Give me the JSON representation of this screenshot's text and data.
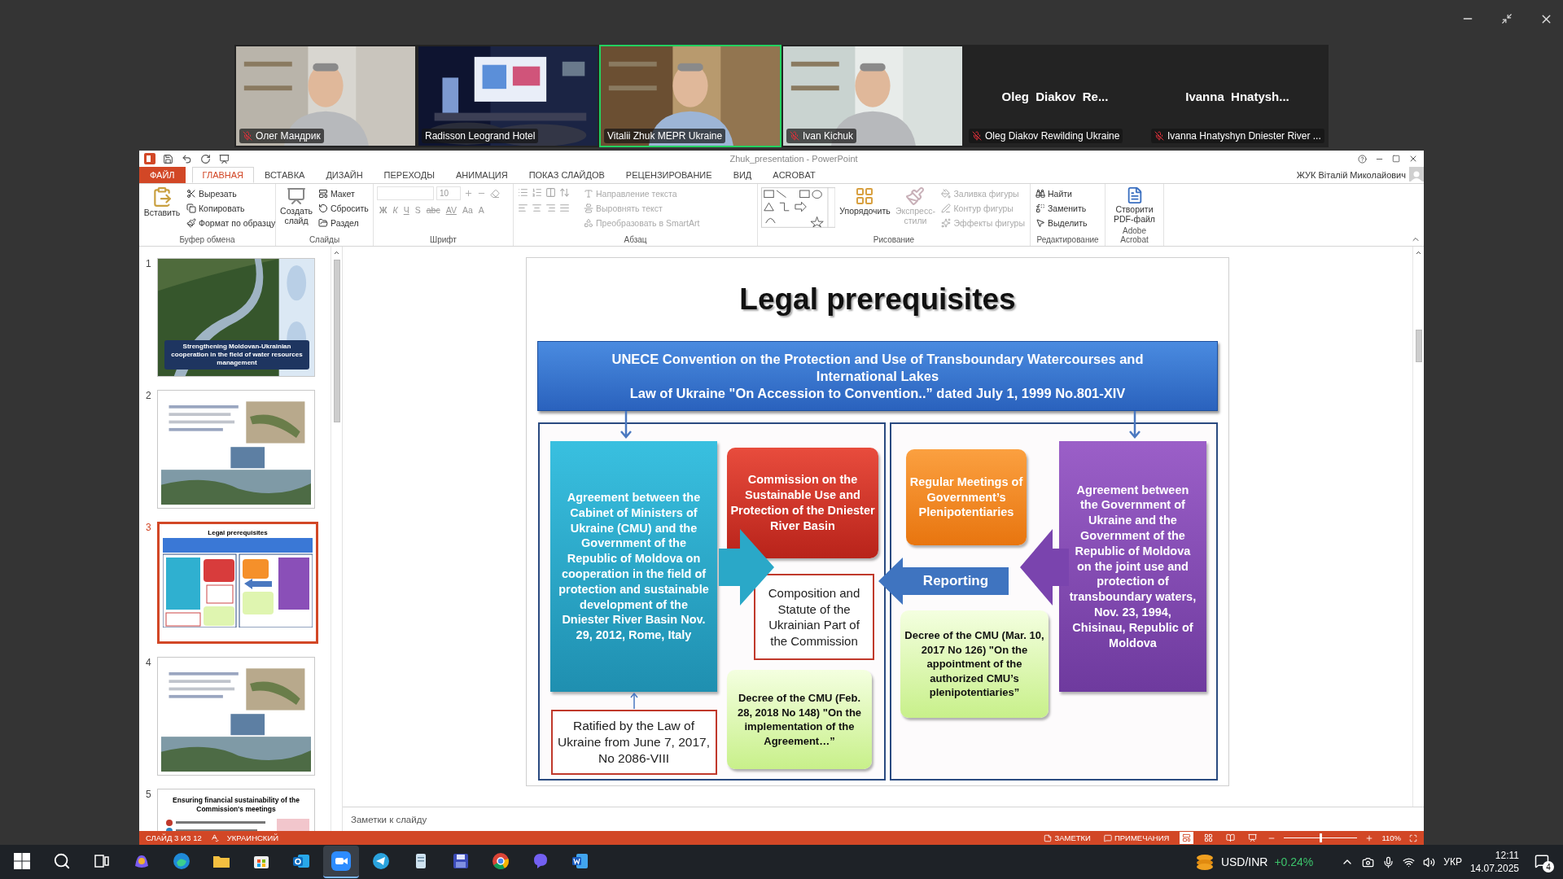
{
  "meeting": {
    "participants": [
      {
        "name": "Олег Мандрик",
        "kind": "video",
        "muted": true,
        "speaking": false
      },
      {
        "name": "Radisson Leogrand Hotel",
        "kind": "video",
        "muted": false,
        "speaking": false
      },
      {
        "name": "Vitalii Zhuk MEPR Ukraine",
        "kind": "video",
        "muted": false,
        "speaking": true
      },
      {
        "name": "Ivan Kichuk",
        "kind": "video",
        "muted": true,
        "speaking": false
      },
      {
        "name": "Oleg Diakov Rewilding Ukraine",
        "display_name": "Oleg  Diakov  Re...",
        "kind": "name",
        "muted": true,
        "speaking": false
      },
      {
        "name": "Ivanna Hnatyshyn Dniester River ...",
        "display_name": "Ivanna  Hnatysh...",
        "kind": "name",
        "muted": true,
        "speaking": false
      }
    ]
  },
  "powerpoint": {
    "title": "Zhuk_presentation - PowerPoint",
    "user": "ЖУК Віталій Миколайович",
    "tabs": [
      {
        "label": "ФАЙЛ",
        "kind": "file",
        "selected": false
      },
      {
        "label": "ГЛАВНАЯ",
        "kind": "tab",
        "selected": true
      },
      {
        "label": "ВСТАВКА",
        "kind": "tab",
        "selected": false
      },
      {
        "label": "ДИЗАЙН",
        "kind": "tab",
        "selected": false
      },
      {
        "label": "ПЕРЕХОДЫ",
        "kind": "tab",
        "selected": false
      },
      {
        "label": "АНИМАЦИЯ",
        "kind": "tab",
        "selected": false
      },
      {
        "label": "ПОКАЗ СЛАЙДОВ",
        "kind": "tab",
        "selected": false
      },
      {
        "label": "РЕЦЕНЗИРОВАНИЕ",
        "kind": "tab",
        "selected": false
      },
      {
        "label": "ВИД",
        "kind": "tab",
        "selected": false
      },
      {
        "label": "ACROBAT",
        "kind": "tab",
        "selected": false
      }
    ],
    "ribbon": {
      "clipboard": {
        "label": "Буфер обмена",
        "paste": {
          "label": "Вставить",
          "disabled": false
        },
        "commands": [
          {
            "label": "Вырезать",
            "disabled": false
          },
          {
            "label": "Копировать",
            "disabled": false
          },
          {
            "label": "Формат по образцу",
            "disabled": false
          }
        ]
      },
      "slides": {
        "label": "Слайды",
        "new_slide": {
          "label": "Создать слайд",
          "disabled": false
        },
        "commands": [
          {
            "label": "Макет",
            "disabled": false
          },
          {
            "label": "Сбросить",
            "disabled": false
          },
          {
            "label": "Раздел",
            "disabled": false
          }
        ]
      },
      "font": {
        "label": "Шрифт",
        "size": "10",
        "disabled": true,
        "buttons": [
          {
            "label": "Ж",
            "kind": "bold"
          },
          {
            "label": "К",
            "kind": "italic"
          },
          {
            "label": "Ч",
            "kind": "underline"
          },
          {
            "label": "S",
            "kind": "shadow"
          },
          {
            "label": "abc",
            "kind": "strike"
          },
          {
            "label": "AV",
            "kind": "spacing"
          },
          {
            "label": "Aa",
            "kind": "case"
          },
          {
            "label": "A",
            "kind": "color"
          }
        ]
      },
      "paragraph": {
        "label": "Абзац",
        "commands": [
          {
            "label": "Направление текста",
            "disabled": true
          },
          {
            "label": "Выровнять текст",
            "disabled": true
          },
          {
            "label": "Преобразовать в SmartArt",
            "disabled": true
          }
        ]
      },
      "drawing": {
        "label": "Рисование",
        "arrange": {
          "label": "Упорядочить",
          "disabled": false
        },
        "quick_styles": {
          "label": "Экспресс-стили",
          "disabled": true
        },
        "commands": [
          {
            "label": "Заливка фигуры",
            "disabled": true
          },
          {
            "label": "Контур фигуры",
            "disabled": true
          },
          {
            "label": "Эффекты фигуры",
            "disabled": true
          }
        ]
      },
      "editing": {
        "label": "Редактирование",
        "commands": [
          {
            "label": "Найти",
            "disabled": false
          },
          {
            "label": "Заменить",
            "disabled": false
          },
          {
            "label": "Выделить",
            "disabled": false
          }
        ]
      },
      "acrobat": {
        "label": "Adobe Acrobat",
        "create_pdf": {
          "label": "Створити PDF-файл",
          "disabled": false
        }
      }
    },
    "thumbnails": [
      {
        "number": "1",
        "kind": "cover",
        "title": "Strengthening Moldovan-Ukrainian cooperation in the field of water resources management",
        "selected": false
      },
      {
        "number": "2",
        "kind": "picture",
        "selected": false
      },
      {
        "number": "3",
        "kind": "diagram",
        "title": "Legal prerequisites",
        "selected": true
      },
      {
        "number": "4",
        "kind": "picture",
        "selected": false
      },
      {
        "number": "5",
        "kind": "heading",
        "title": "Ensuring financial sustainability of the Commission's meetings",
        "selected": false
      }
    ],
    "slide": {
      "title": "Legal prerequisites",
      "banner": [
        "UNECE Convention on the Protection and Use of Transboundary Watercourses and International Lakes",
        "Law of Ukraine \"On Accession to Convention..” dated July 1, 1999 No.801-XIV"
      ],
      "left": {
        "agreement": "Agreement between the Cabinet of Ministers of Ukraine (CMU) and the Government of the Republic of Moldova on cooperation in the field of protection and sustainable development of the Dniester River Basin Nov. 29, 2012,   Rome, Italy",
        "ratified": "Ratified by the Law of Ukraine from June 7, 2017, No 2086-VIII",
        "commission": "Commission on the Sustainable Use and Protection of the Dniester River Basin",
        "composition": "Composition and Statute of the Ukrainian Part of the Commission",
        "decree": "Decree of the CMU (Feb. 28, 2018 No 148)   \"On the implementation of the Agreement…”"
      },
      "right": {
        "meetings": "Regular Meetings of Government’s Plenipotentiaries",
        "reporting": "Reporting",
        "decree": "Decree of the CMU (Mar. 10, 2017 No 126)   \"On the appointment of the authorized CMU’s plenipotentiaries”",
        "agreement": "Agreement between the Government of Ukraine and the Government of the Republic of Moldova on the joint use and protection of transboundary waters, Nov. 23, 1994, Chisinau, Republic of Moldova"
      }
    },
    "notes": {
      "placeholder": "Заметки к слайду"
    },
    "status_bar": {
      "slide_info": "СЛАЙД 3 ИЗ 12",
      "language": "УКРАИНСКИЙ",
      "notes": "ЗАМЕТКИ",
      "comments": "ПРИМЕЧАНИЯ",
      "views": [
        {
          "kind": "normal",
          "selected": true
        },
        {
          "kind": "sorter",
          "selected": false
        },
        {
          "kind": "reading",
          "selected": false
        },
        {
          "kind": "show",
          "selected": false
        }
      ],
      "zoom": {
        "level": 0.5,
        "reading": "110%"
      }
    }
  },
  "taskbar": {
    "apps": [
      {
        "kind": "copilot",
        "selected": false
      },
      {
        "kind": "edge",
        "selected": false
      },
      {
        "kind": "explorer",
        "selected": false
      },
      {
        "kind": "store",
        "selected": false
      },
      {
        "kind": "outlook",
        "selected": false
      },
      {
        "kind": "zoom",
        "selected": true
      },
      {
        "kind": "telegram",
        "selected": false
      },
      {
        "kind": "notepad",
        "selected": false
      },
      {
        "kind": "disk",
        "selected": false
      },
      {
        "kind": "chrome",
        "selected": false
      },
      {
        "kind": "viber",
        "selected": false
      },
      {
        "kind": "word",
        "selected": false
      }
    ],
    "ticker": {
      "symbol": "USD/INR",
      "change": "+0.24%"
    },
    "language": "УКР",
    "time": "12:11",
    "date": "14.07.2025",
    "notifications": "4"
  }
}
